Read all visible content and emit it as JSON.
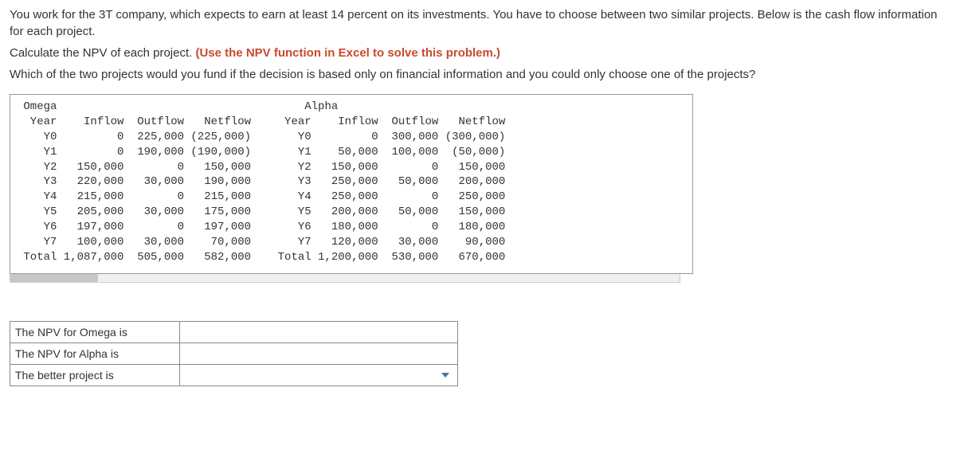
{
  "intro": {
    "p1": "You work for the 3T company, which expects to earn at least 14 percent on its investments. You have to choose between two similar projects. Below is the cash flow information for each project.",
    "p2_prefix": "Calculate the NPV of each project. ",
    "p2_hint": "(Use the NPV function in Excel to solve this problem.)",
    "p3": "Which of the two projects would you fund if the decision is based only on financial information and you could only choose one of the projects?"
  },
  "projects": {
    "omega": {
      "name": "Omega",
      "headers": [
        "Year",
        "Inflow",
        "Outflow",
        "Netflow"
      ],
      "rows": [
        [
          "Y0",
          "0",
          "225,000",
          "(225,000)"
        ],
        [
          "Y1",
          "0",
          "190,000",
          "(190,000)"
        ],
        [
          "Y2",
          "150,000",
          "0",
          "150,000"
        ],
        [
          "Y3",
          "220,000",
          "30,000",
          "190,000"
        ],
        [
          "Y4",
          "215,000",
          "0",
          "215,000"
        ],
        [
          "Y5",
          "205,000",
          "30,000",
          "175,000"
        ],
        [
          "Y6",
          "197,000",
          "0",
          "197,000"
        ],
        [
          "Y7",
          "100,000",
          "30,000",
          "70,000"
        ],
        [
          "Total",
          "1,087,000",
          "505,000",
          "582,000"
        ]
      ]
    },
    "alpha": {
      "name": "Alpha",
      "headers": [
        "Year",
        "Inflow",
        "Outflow",
        "Netflow"
      ],
      "rows": [
        [
          "Y0",
          "0",
          "300,000",
          "(300,000)"
        ],
        [
          "Y1",
          "50,000",
          "100,000",
          "(50,000)"
        ],
        [
          "Y2",
          "150,000",
          "0",
          "150,000"
        ],
        [
          "Y3",
          "250,000",
          "50,000",
          "200,000"
        ],
        [
          "Y4",
          "250,000",
          "0",
          "250,000"
        ],
        [
          "Y5",
          "200,000",
          "50,000",
          "150,000"
        ],
        [
          "Y6",
          "180,000",
          "0",
          "180,000"
        ],
        [
          "Y7",
          "120,000",
          "30,000",
          "90,000"
        ],
        [
          "Total",
          "1,200,000",
          "530,000",
          "670,000"
        ]
      ]
    }
  },
  "answers": {
    "row1_label": "The NPV for Omega is",
    "row2_label": "The NPV for Alpha is",
    "row3_label": "The better project is"
  }
}
